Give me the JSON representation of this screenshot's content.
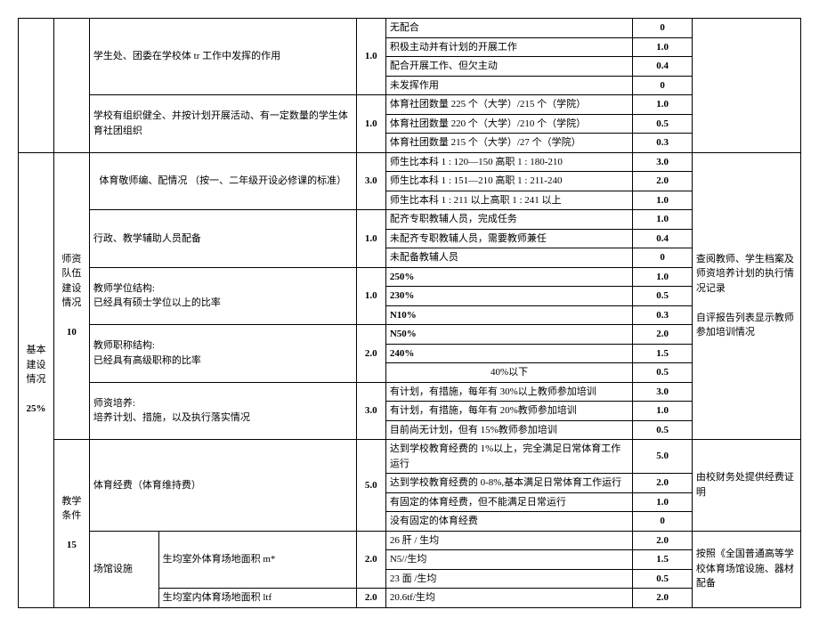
{
  "cat0": {
    "label": ""
  },
  "cat1": {
    "label": "基本建设情况",
    "pct": "25%"
  },
  "sub1": {
    "r1": {
      "desc": "学生处、团委在学校体 tr 工作中发挥的作用",
      "pts": "1.0"
    },
    "r2": {
      "desc": "学校有组织健全、并按计划开展活动、有一定数量的学生体育社团组织",
      "pts": "1.0"
    }
  },
  "sub2": {
    "name": "师资队伍建设情况",
    "pts": "10",
    "r1": {
      "desc": "体育敬师编、配情况\n（按一、二年级开设必修课的标准）",
      "pts": "3.0"
    },
    "r2": {
      "desc": "行政、教学辅助人员配备",
      "pts": "1.0"
    },
    "r3": {
      "desc": "教师学位结构:\n已经具有硕士学位以上的比率",
      "pts": "1.0"
    },
    "r4": {
      "desc": "教师职称结构:\n已经具有高级职称的比率",
      "pts": "2.0"
    },
    "r5": {
      "desc": "师资培养:\n培养计划、措施，以及执行落实情况",
      "pts": "3.0"
    }
  },
  "sub3": {
    "name": "教学条件",
    "pts": "15",
    "r1": {
      "desc": "体育经费（体育维持费）",
      "pts": "5.0"
    },
    "r2": {
      "desc": "场馆设施",
      "sub1": "生均室外体育场地面积 m*",
      "sub1pts": "2.0",
      "sub2": "生均室内体育场地面积 ltf",
      "sub2pts": "2.0"
    }
  },
  "crit": {
    "a1": "无配合",
    "a1s": "0",
    "a2": "积极主动并有计划的开展工作",
    "a2s": "1.0",
    "a3": "配合开展工作、但欠主动",
    "a3s": "0.4",
    "a4": "未发挥作用",
    "a4s": "0",
    "b1": "体育社团数量 225 个（大学）/215 个（学院）",
    "b1s": "1.0",
    "b2": "体育社团数量 220 个（大学）/210 个（学院）",
    "b2s": "0.5",
    "b3": "体育社团数量 215 个（大学）/27 个（学院）",
    "b3s": "0.3",
    "c1": "师生比本科 1 : 120—150 高职 1 : 180-210",
    "c1s": "3.0",
    "c2": "师生比本科 1 : 151—210 高职 1 : 211-240",
    "c2s": "2.0",
    "c3": "师生比本科 1 : 211 以上高职 1 : 241 以上",
    "c3s": "1.0",
    "d1": "配齐专职教辅人员，完成任务",
    "d1s": "1.0",
    "d2": "未配齐专职教辅人员，需要教师兼任",
    "d2s": "0.4",
    "d3": "未配备教辅人员",
    "d3s": "0",
    "e1": "250%",
    "e1s": "1.0",
    "e2": "230%",
    "e2s": "0.5",
    "e3": "N10%",
    "e3s": "0.3",
    "f1": "N50%",
    "f1s": "2.0",
    "f2": "240%",
    "f2s": "1.5",
    "f3": "40%以下",
    "f3s": "0.5",
    "g1": "有计划，有措施，每年有 30%以上教师参加培训",
    "g1s": "3.0",
    "g2": "有计划，有措施，每年有 20%教师参加培训",
    "g2s": "1.0",
    "g3": "目前尚无计划，但有 15%教师参加培训",
    "g3s": "0.5",
    "h1": "达到学校教育经费的 1%以上，完全满足日常体育工作运行",
    "h1s": "5.0",
    "h2": "达到学校教育经费的 0-8%,基本满足日常体育工作运行",
    "h2s": "2.0",
    "h3": "有固定的体育经费，但不能满足日常运行",
    "h3s": "1.0",
    "h4": "没有固定的体育经费",
    "h4s": "0",
    "i1": "26 肝 / 生均",
    "i1s": "2.0",
    "i2": "N5//生均",
    "i2s": "1.5",
    "i3": "23 面 /生均",
    "i3s": "0.5",
    "j1": "20.6tf/生均",
    "j1s": "2.0"
  },
  "notes": {
    "n2": "查阅教师、学生档案及师资培养计划的执行情况记录\n\n自评报告列表显示教师参加培训情况",
    "n3": "由校财务处提供经费证明",
    "n4": "按照《全国普通高等学校体育场馆设施、器材配备"
  }
}
